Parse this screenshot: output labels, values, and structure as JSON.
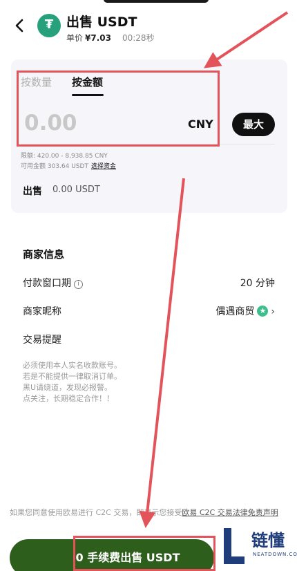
{
  "header": {
    "title": "出售 USDT",
    "price_label": "单价",
    "price_value": "¥7.03",
    "timer": "00:28秒",
    "coin_symbol": "₮"
  },
  "form": {
    "tabs": [
      {
        "label": "按数量",
        "active": false
      },
      {
        "label": "按金额",
        "active": true
      }
    ],
    "amount_placeholder": "0.00",
    "currency": "CNY",
    "max_label": "最大",
    "limit_text": "限额: 420.00 - 8,938.85 CNY",
    "available_text": "可用金额 303.64 USDT",
    "select_funds_link": "选择资金",
    "sell_label": "出售",
    "sell_value": "0.00 USDT"
  },
  "merchant": {
    "title": "商家信息",
    "rows": [
      {
        "label": "付款窗口期",
        "value": "20 分钟"
      },
      {
        "label": "商家昵称",
        "value": "偶遇商贸"
      },
      {
        "label": "交易提醒",
        "value": ""
      }
    ],
    "notes": [
      "必须使用本人实名收款账号。",
      "若是不能提供一律取消订单。",
      "黑U请绕道，发现必报警。",
      "点关注，长期稳定合作！！"
    ]
  },
  "footer": {
    "agreement_prefix": "如果您同意使用欧易进行 C2C 交易，即表示您接受",
    "agreement_link": "欧易 C2C 交易法律免责声明",
    "sell_button": "0 手续费出售 USDT"
  },
  "watermark": {
    "brand": "链懂",
    "site": "NEATDOWN.COM"
  },
  "colors": {
    "accent_green": "#2e5e1c",
    "tether": "#26a17b",
    "annotation": "#e2535a",
    "card_bg": "#f6f5fa"
  }
}
